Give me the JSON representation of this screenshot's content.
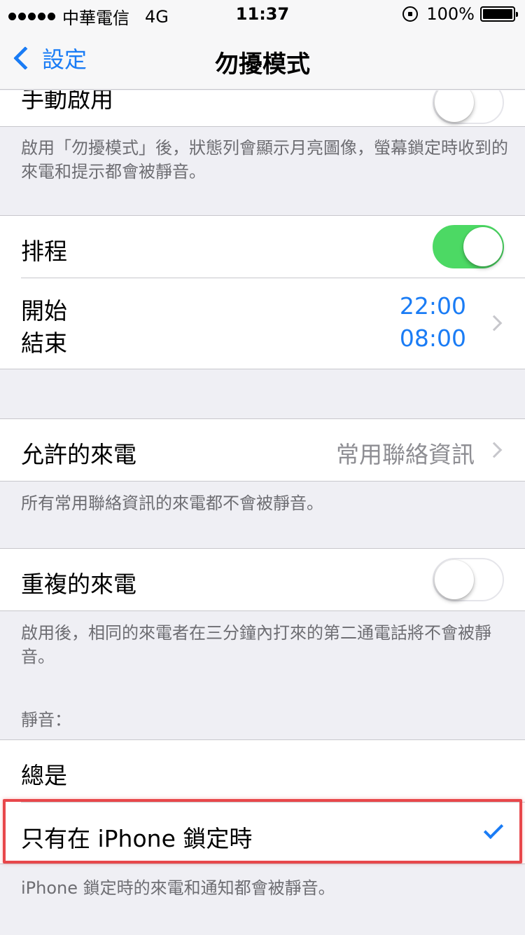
{
  "status_bar": {
    "carrier": "中華電信",
    "network": "4G",
    "time": "11:37",
    "battery": "100%"
  },
  "nav": {
    "back_label": "設定",
    "title": "勿擾模式"
  },
  "manual": {
    "label": "手動啟用",
    "enabled": false,
    "footer": "啟用「勿擾模式」後，狀態列會顯示月亮圖像，螢幕鎖定時收到的來電和提示都會被靜音。"
  },
  "schedule": {
    "label": "排程",
    "enabled": true,
    "start_label": "開始",
    "end_label": "結束",
    "start_time": "22:00",
    "end_time": "08:00"
  },
  "allow_calls": {
    "label": "允許的來電",
    "value": "常用聯絡資訊",
    "footer": "所有常用聯絡資訊的來電都不會被靜音。"
  },
  "repeated_calls": {
    "label": "重複的來電",
    "enabled": false,
    "footer": "啟用後，相同的來電者在三分鐘內打來的第二通電話將不會被靜音。"
  },
  "silence": {
    "header": "靜音：",
    "options": [
      {
        "label": "總是",
        "selected": false
      },
      {
        "label": "只有在 iPhone 鎖定時",
        "selected": true
      }
    ],
    "footer": "iPhone 鎖定時的來電和通知都會被靜音。"
  },
  "colors": {
    "accent": "#1a7cf5",
    "toggle_on": "#4cd964",
    "highlight": "#e8474b"
  }
}
